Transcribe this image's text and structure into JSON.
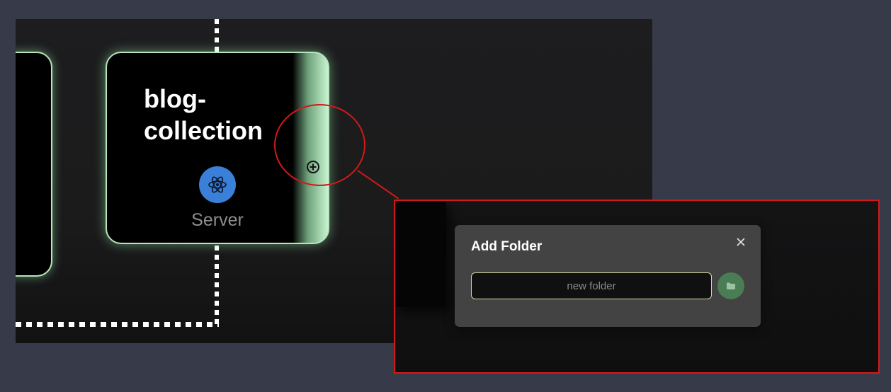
{
  "canvas": {
    "node": {
      "title": "blog-\ncollection",
      "type_label": "Server",
      "badge_icon": "atom-icon",
      "add_icon": "plus-circle-icon"
    },
    "colors": {
      "node_border": "#b7e5bd",
      "badge": "#3b80d8",
      "highlight": "#d11919"
    }
  },
  "modal": {
    "title": "Add Folder",
    "input": {
      "value": "",
      "placeholder": "new folder"
    },
    "submit_icon": "folder-icon",
    "close_icon": "close-icon",
    "colors": {
      "panel": "#434343",
      "submit": "#4b7d54",
      "input_border": "#d9d7a6"
    }
  }
}
